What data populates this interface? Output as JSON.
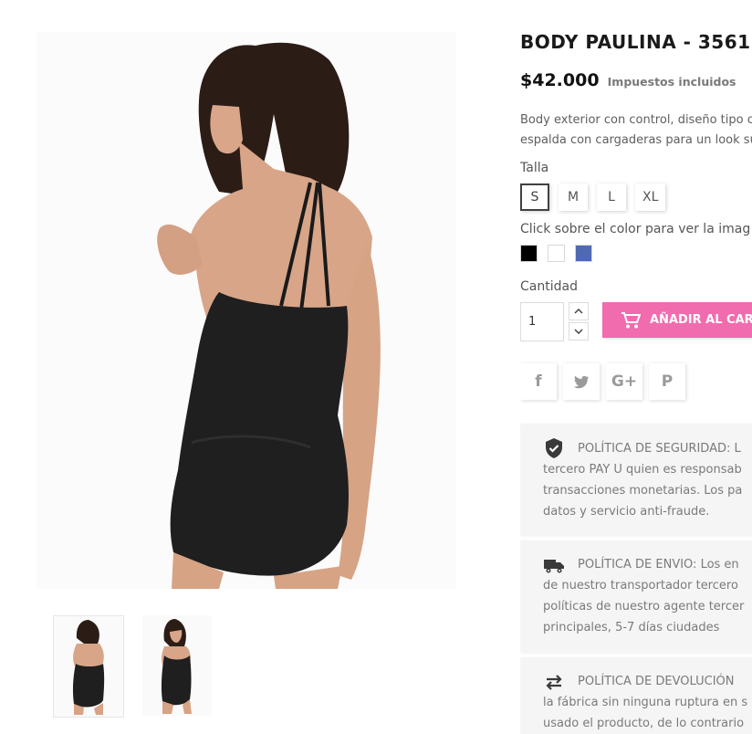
{
  "product": {
    "title": "BODY PAULINA - 3561",
    "price": "$42.000",
    "tax_note": "Impuestos incluidos",
    "description_lines": [
      "Body exterior con control, diseño tipo ca",
      "espalda con cargaderas para un look su"
    ]
  },
  "size": {
    "label": "Talla",
    "options": [
      "S",
      "M",
      "L",
      "XL"
    ],
    "selected": "S"
  },
  "color": {
    "label": "Click sobre el color para ver la imag",
    "swatches": [
      "#000000",
      "#ffffff",
      "#4f6ab1"
    ]
  },
  "quantity": {
    "label": "Cantidad",
    "value": "1"
  },
  "cart_button": {
    "label": "AÑADIR AL CARR",
    "color": "#f06cae"
  },
  "share": {
    "facebook": "f",
    "twitter": "twitter-icon",
    "googleplus": "G+",
    "pinterest": "P"
  },
  "policies": [
    {
      "icon": "shield-check-icon",
      "lines": [
        "POLÍTICA DE SEGURIDAD: L",
        "tercero PAY U quien es responsab",
        "transacciones monetarias. Los pa",
        "datos y servicio anti-fraude."
      ]
    },
    {
      "icon": "truck-icon",
      "lines": [
        "POLÍTICA DE ENVIO: Los en",
        "de nuestro transportador tercero",
        "políticas de nuestro agente tercer",
        "principales, 5-7 días ciudades"
      ]
    },
    {
      "icon": "exchange-arrows-icon",
      "lines": [
        "POLÍTICA DE DEVOLUCIÓN",
        "la fábrica sin ninguna ruptura en s",
        "usado el producto, de lo contrario"
      ]
    }
  ]
}
